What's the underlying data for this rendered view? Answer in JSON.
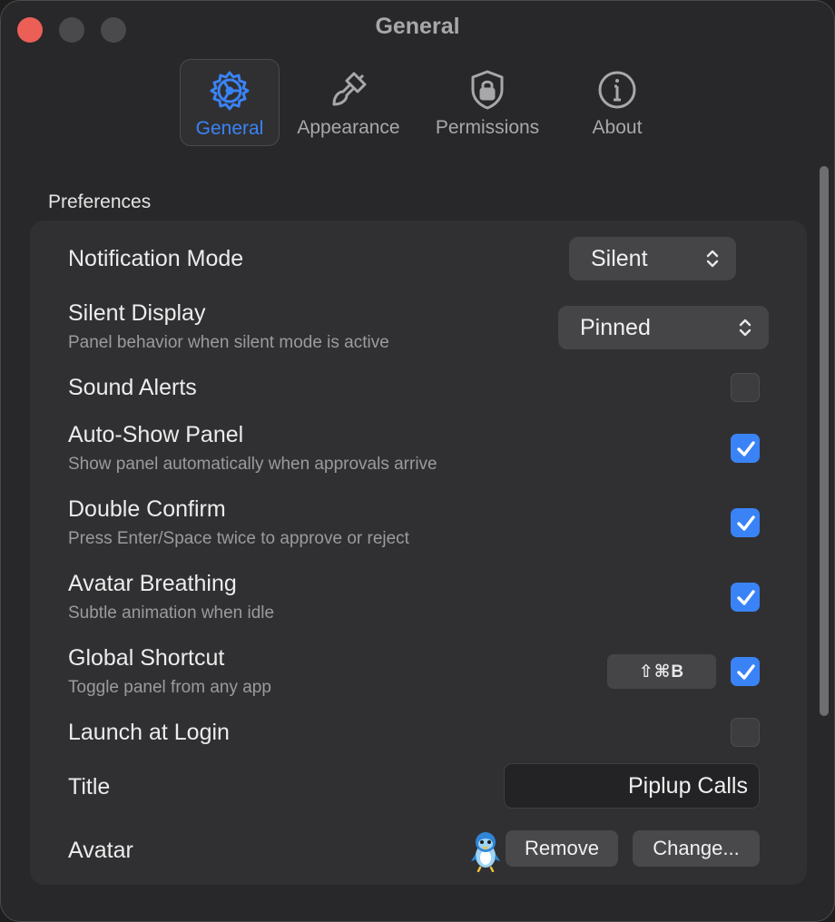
{
  "window": {
    "title": "General"
  },
  "tabs": [
    {
      "label": "General",
      "icon": "gear-icon",
      "active": true
    },
    {
      "label": "Appearance",
      "icon": "paintbrush-icon",
      "active": false
    },
    {
      "label": "Permissions",
      "icon": "shield-lock-icon",
      "active": false
    },
    {
      "label": "About",
      "icon": "info-icon",
      "active": false
    }
  ],
  "section": {
    "label": "Preferences"
  },
  "settings": {
    "notification_mode": {
      "label": "Notification Mode",
      "value": "Silent"
    },
    "silent_display": {
      "label": "Silent Display",
      "description": "Panel behavior when silent mode is active",
      "value": "Pinned"
    },
    "sound_alerts": {
      "label": "Sound Alerts",
      "checked": false
    },
    "auto_show_panel": {
      "label": "Auto-Show Panel",
      "description": "Show panel automatically when approvals arrive",
      "checked": true
    },
    "double_confirm": {
      "label": "Double Confirm",
      "description": "Press Enter/Space twice to approve or reject",
      "checked": true
    },
    "avatar_breathing": {
      "label": "Avatar Breathing",
      "description": "Subtle animation when idle",
      "checked": true
    },
    "global_shortcut": {
      "label": "Global Shortcut",
      "description": "Toggle panel from any app",
      "shortcut": "⇧⌘B",
      "checked": true
    },
    "launch_at_login": {
      "label": "Launch at Login",
      "checked": false
    },
    "title": {
      "label": "Title",
      "value": "Piplup Calls"
    },
    "avatar": {
      "label": "Avatar",
      "remove_label": "Remove",
      "change_label": "Change..."
    }
  },
  "colors": {
    "accent": "#3a83f6",
    "close": "#ec5f57",
    "panel": "#303033",
    "window": "#28282a"
  }
}
